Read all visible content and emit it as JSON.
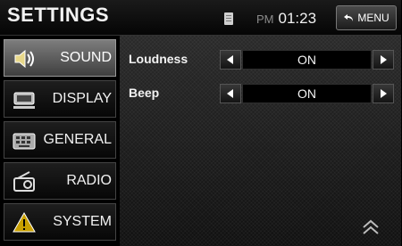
{
  "header": {
    "title": "SETTINGS",
    "ampm": "PM",
    "time": "01:23",
    "menu_label": "MENU",
    "sd_icon": "sd-card-icon",
    "back_icon": "return-arrow-icon"
  },
  "sidebar": {
    "items": [
      {
        "label": "SOUND",
        "icon": "speaker-icon",
        "active": true
      },
      {
        "label": "DISPLAY",
        "icon": "display-icon",
        "active": false
      },
      {
        "label": "GENERAL",
        "icon": "keyboard-icon",
        "active": false
      },
      {
        "label": "RADIO",
        "icon": "radio-icon",
        "active": false
      },
      {
        "label": "SYSTEM",
        "icon": "warning-icon",
        "active": false
      }
    ]
  },
  "settings": {
    "rows": [
      {
        "label": "Loudness",
        "value": "ON"
      },
      {
        "label": "Beep",
        "value": "ON"
      }
    ]
  },
  "footer": {
    "scroll_icon": "double-chevron-up-icon"
  },
  "colors": {
    "background": "#000000",
    "active_tab": "#6a6a6a",
    "text": "#ffffff"
  }
}
